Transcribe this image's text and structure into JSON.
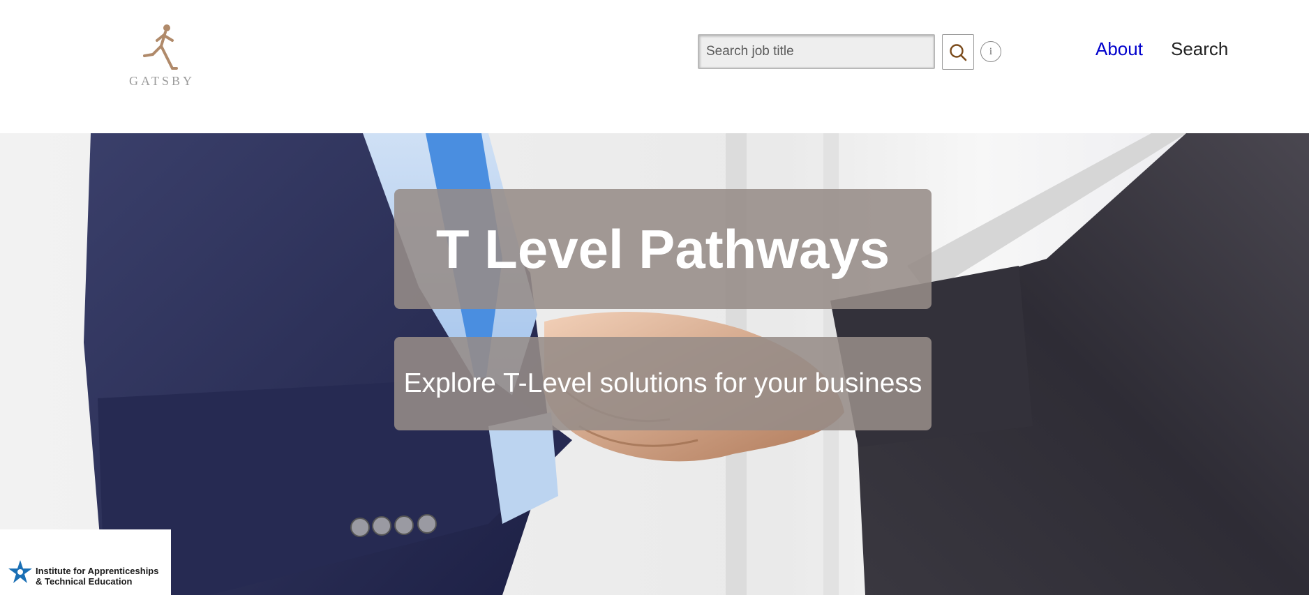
{
  "header": {
    "logo": {
      "text": "GATSBY",
      "icon": "running-mannequin-icon"
    },
    "search": {
      "placeholder": "Search job title",
      "value": ""
    },
    "search_button_icon": "search-icon",
    "info_button": {
      "label": "i",
      "icon": "info-icon"
    },
    "nav": [
      {
        "label": "About",
        "color": "#0000cc"
      },
      {
        "label": "Search",
        "color": "#222222"
      }
    ]
  },
  "hero": {
    "title": "T Level Pathways",
    "subtitle": "Explore T-Level solutions for your business",
    "background": "business-handshake-photo",
    "overlay_color": "#968c88"
  },
  "footer_badge": {
    "line1": "Institute for Apprenticeships",
    "line2": "& Technical Education",
    "icon": "star-logo-icon",
    "brand_color": "#1a6fb5"
  }
}
